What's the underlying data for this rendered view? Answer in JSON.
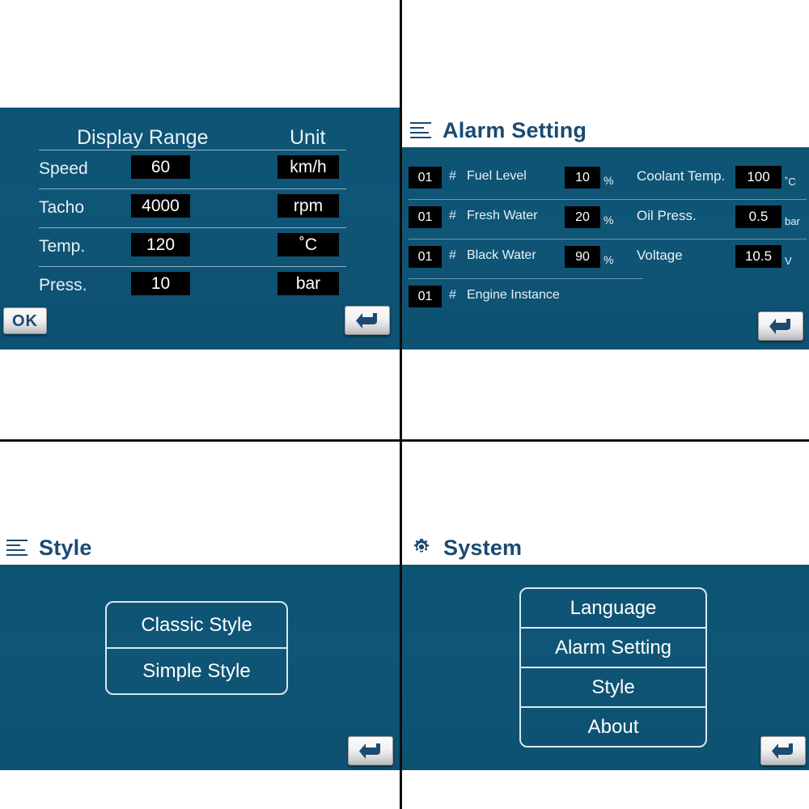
{
  "colors": {
    "screen_blue": "#0d5273",
    "title_blue": "#1b4a72",
    "lcd_bg": "#000000",
    "lcd_text": "#ffffff",
    "rule": "#8fb3c4",
    "panel_white": "#ffffff",
    "divider": "#0c0c0c"
  },
  "panels": {
    "display_range": {
      "headers": {
        "range": "Display Range",
        "unit": "Unit"
      },
      "rows": [
        {
          "name": "Speed",
          "value": "60",
          "unit": "km/h"
        },
        {
          "name": "Tacho",
          "value": "4000",
          "unit": "rpm"
        },
        {
          "name": "Temp.",
          "value": "120",
          "unit": "˚C"
        },
        {
          "name": "Press.",
          "value": "10",
          "unit": "bar"
        }
      ],
      "ok_label": "OK",
      "enter_icon": "enter-return-icon"
    },
    "alarm_setting": {
      "title": "Alarm Setting",
      "icon": "list-lines-icon",
      "left_rows": [
        {
          "index": "01",
          "hash": "#",
          "label": "Fuel Level",
          "value": "10",
          "unit": "%"
        },
        {
          "index": "01",
          "hash": "#",
          "label": "Fresh Water",
          "value": "20",
          "unit": "%"
        },
        {
          "index": "01",
          "hash": "#",
          "label": "Black Water",
          "value": "90",
          "unit": "%"
        },
        {
          "index": "01",
          "hash": "#",
          "label": "Engine Instance",
          "value": "",
          "unit": ""
        }
      ],
      "right_rows": [
        {
          "label": "Coolant Temp.",
          "value": "100",
          "unit": "˚C"
        },
        {
          "label": "Oil Press.",
          "value": "0.5",
          "unit": "bar"
        },
        {
          "label": "Voltage",
          "value": "10.5",
          "unit": "V"
        }
      ],
      "enter_icon": "enter-return-icon"
    },
    "style": {
      "title": "Style",
      "icon": "list-lines-icon",
      "options": [
        {
          "label": "Classic Style"
        },
        {
          "label": "Simple Style"
        }
      ],
      "enter_icon": "enter-return-icon"
    },
    "system": {
      "title": "System",
      "icon": "gear-icon",
      "options": [
        {
          "label": "Language"
        },
        {
          "label": "Alarm Setting"
        },
        {
          "label": "Style"
        },
        {
          "label": "About"
        }
      ],
      "enter_icon": "enter-return-icon"
    }
  }
}
